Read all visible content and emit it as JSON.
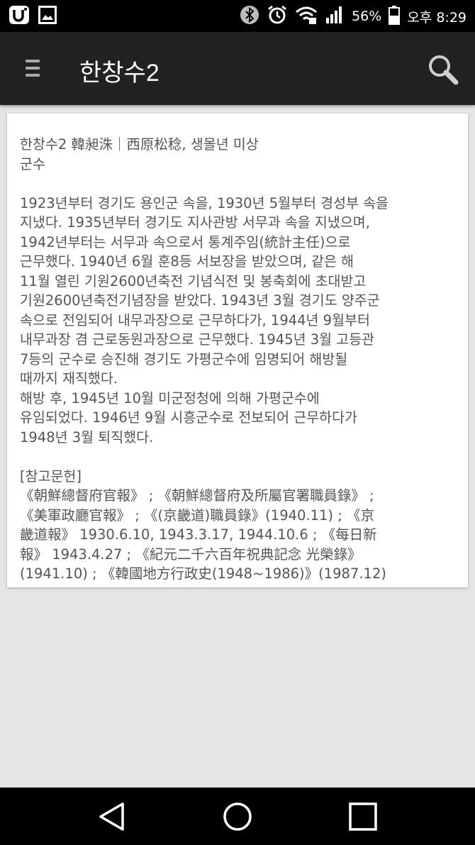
{
  "status_bar": {
    "left_icons": [
      "carrier-u-icon",
      "gallery-icon"
    ],
    "right_icons": [
      "bluetooth-icon",
      "alarm-icon",
      "wifi-icon",
      "signal-icon",
      "battery-icon"
    ],
    "battery_percent": "56%",
    "time": "오후 8:29"
  },
  "app_bar": {
    "title": "한창수2",
    "menu_icon": "menu-icon",
    "search_icon": "search-icon"
  },
  "article": {
    "header": "한창수2 韓昶洙｜西原松稔, 생몰년 미상",
    "position": "군수",
    "body_lines": [
      "1923년부터 경기도 용인군 속을, 1930년 5월부터 경성부 속을",
      "지냈다. 1935년부터 경기도 지사관방 서무과 속을 지냈으며,",
      "1942년부터는 서무과 속으로서 통계주임(統計主任)으로",
      "근무했다. 1940년 6월 훈8등 서보장을 받았으며, 같은 해",
      "11월 열린 기원2600년축전 기념식전 및 봉축회에 초대받고",
      "기원2600년축전기념장을 받았다. 1943년 3월 경기도 양주군",
      "속으로 전임되어 내무과장으로 근무하다가, 1944년 9월부터",
      "내무과장 겸 근로동원과장으로 근무했다. 1945년 3월 고등관",
      "7등의 군수로 승진해 경기도 가평군수에 임명되어 해방될",
      "때까지 재직했다.",
      "해방 후, 1945년 10월 미군정청에 의해 가평군수에",
      "유임되었다. 1946년 9월 시흥군수로 전보되어 근무하다가",
      "1948년 3월 퇴직했다."
    ],
    "references_title": "[참고문헌]",
    "reference_lines": [
      "《朝鮮總督府官報》 ; 《朝鮮總督府及所屬官署職員錄》 ;",
      "《美軍政廳官報》 ; 《(京畿道)職員錄》(1940.11) ; 《京",
      "畿道報》 1930.6.10, 1943.3.17, 1944.10.6 ; 《每日新",
      "報》 1943.4.27 ; 《紀元二千六百年祝典記念 光榮錄》",
      "(1941.10) ; 《韓國地方行政史(1948~1986)》(1987.12)"
    ]
  },
  "nav_bar": {
    "back_icon": "back-triangle-icon",
    "home_icon": "home-circle-icon",
    "recents_icon": "recents-square-icon"
  }
}
